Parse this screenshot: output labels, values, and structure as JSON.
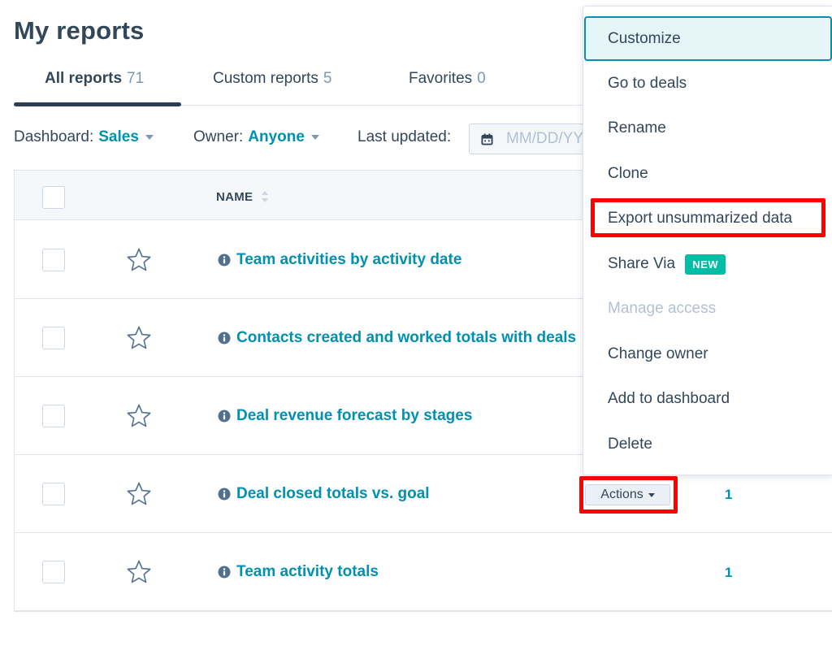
{
  "page": {
    "title": "My reports"
  },
  "tabs": [
    {
      "label": "All reports",
      "count": "71",
      "active": true
    },
    {
      "label": "Custom reports",
      "count": "5",
      "active": false
    },
    {
      "label": "Favorites",
      "count": "0",
      "active": false
    }
  ],
  "filters": {
    "dashboard": {
      "label": "Dashboard:",
      "value": "Sales"
    },
    "owner": {
      "label": "Owner:",
      "value": "Anyone"
    },
    "last_updated": {
      "label": "Last updated:",
      "placeholder": "MM/DD/YYYY"
    }
  },
  "table": {
    "columns": {
      "name": "NAME"
    },
    "rows": [
      {
        "name": "Team activities by activity date",
        "count": ""
      },
      {
        "name": "Contacts created and worked totals with deals",
        "count": ""
      },
      {
        "name": "Deal revenue forecast by stages",
        "count": ""
      },
      {
        "name": "Deal closed totals vs. goal",
        "count": "1"
      },
      {
        "name": "Team activity totals",
        "count": "1"
      }
    ]
  },
  "actions_button": {
    "label": "Actions"
  },
  "dropdown": {
    "items": [
      {
        "label": "Customize",
        "state": "focused"
      },
      {
        "label": "Go to deals",
        "state": "normal"
      },
      {
        "label": "Rename",
        "state": "normal"
      },
      {
        "label": "Clone",
        "state": "normal"
      },
      {
        "label": "Export unsummarized data",
        "state": "normal"
      },
      {
        "label": "Share Via",
        "badge": "NEW",
        "state": "normal"
      },
      {
        "label": "Manage access",
        "state": "disabled"
      },
      {
        "label": "Change owner",
        "state": "normal"
      },
      {
        "label": "Add to dashboard",
        "state": "normal"
      },
      {
        "label": "Delete",
        "state": "normal"
      }
    ]
  },
  "icons": {
    "star": "star-outline-icon",
    "info": "info-circle-icon",
    "calendar": "calendar-icon",
    "sort": "sort-icon"
  },
  "colors": {
    "text": "#33475b",
    "link": "#0091ae",
    "muted": "#7c98b6",
    "disabled": "#b0c1d4",
    "badge": "#00bda5",
    "annotation": "#ff0000",
    "focus_bg": "#e5f5f8"
  }
}
